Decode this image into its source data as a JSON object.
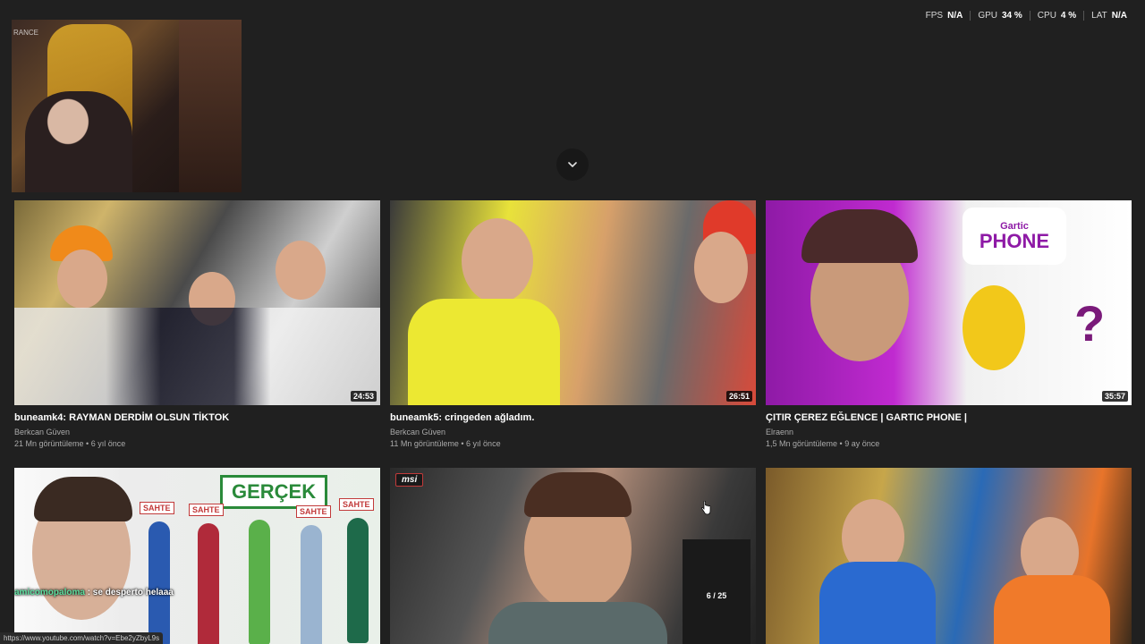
{
  "stats": {
    "fps_label": "FPS",
    "fps_value": "N/A",
    "gpu_label": "GPU",
    "gpu_value": "34 %",
    "cpu_label": "CPU",
    "cpu_value": "4 %",
    "lat_label": "LAT",
    "lat_value": "N/A"
  },
  "webcam": {
    "chair_logo": "RANCE"
  },
  "videos": [
    {
      "title": "buneamk4: RAYMAN DERDİM OLSUN TİKTOK",
      "channel": "Berkcan Güven",
      "views": "21 Mn görüntüleme",
      "age": "6 yıl önce",
      "duration": "24:53"
    },
    {
      "title": "buneamk5: cringeden ağladım.",
      "channel": "Berkcan Güven",
      "views": "11 Mn görüntüleme",
      "age": "6 yıl önce",
      "duration": "26:51"
    },
    {
      "title": "ÇITIR ÇEREZ EĞLENCE | GARTIC PHONE |",
      "channel": "Elraenn",
      "views": "1,5 Mn görüntüleme",
      "age": "9 ay önce",
      "duration": "35:57"
    }
  ],
  "row2": {
    "gartic_top": "Gartic",
    "gartic_bottom": "PHONE",
    "gercek": "GERÇEK",
    "sahte": "SAHTE",
    "chat_user": "amicomopaloma",
    "chat_text": " : se desperto helaaa",
    "msi": "msi",
    "inset_count": "6 / 25"
  },
  "meta_separator": " • ",
  "status_url": "https://www.youtube.com/watch?v=Ebe2yZbyL9s"
}
